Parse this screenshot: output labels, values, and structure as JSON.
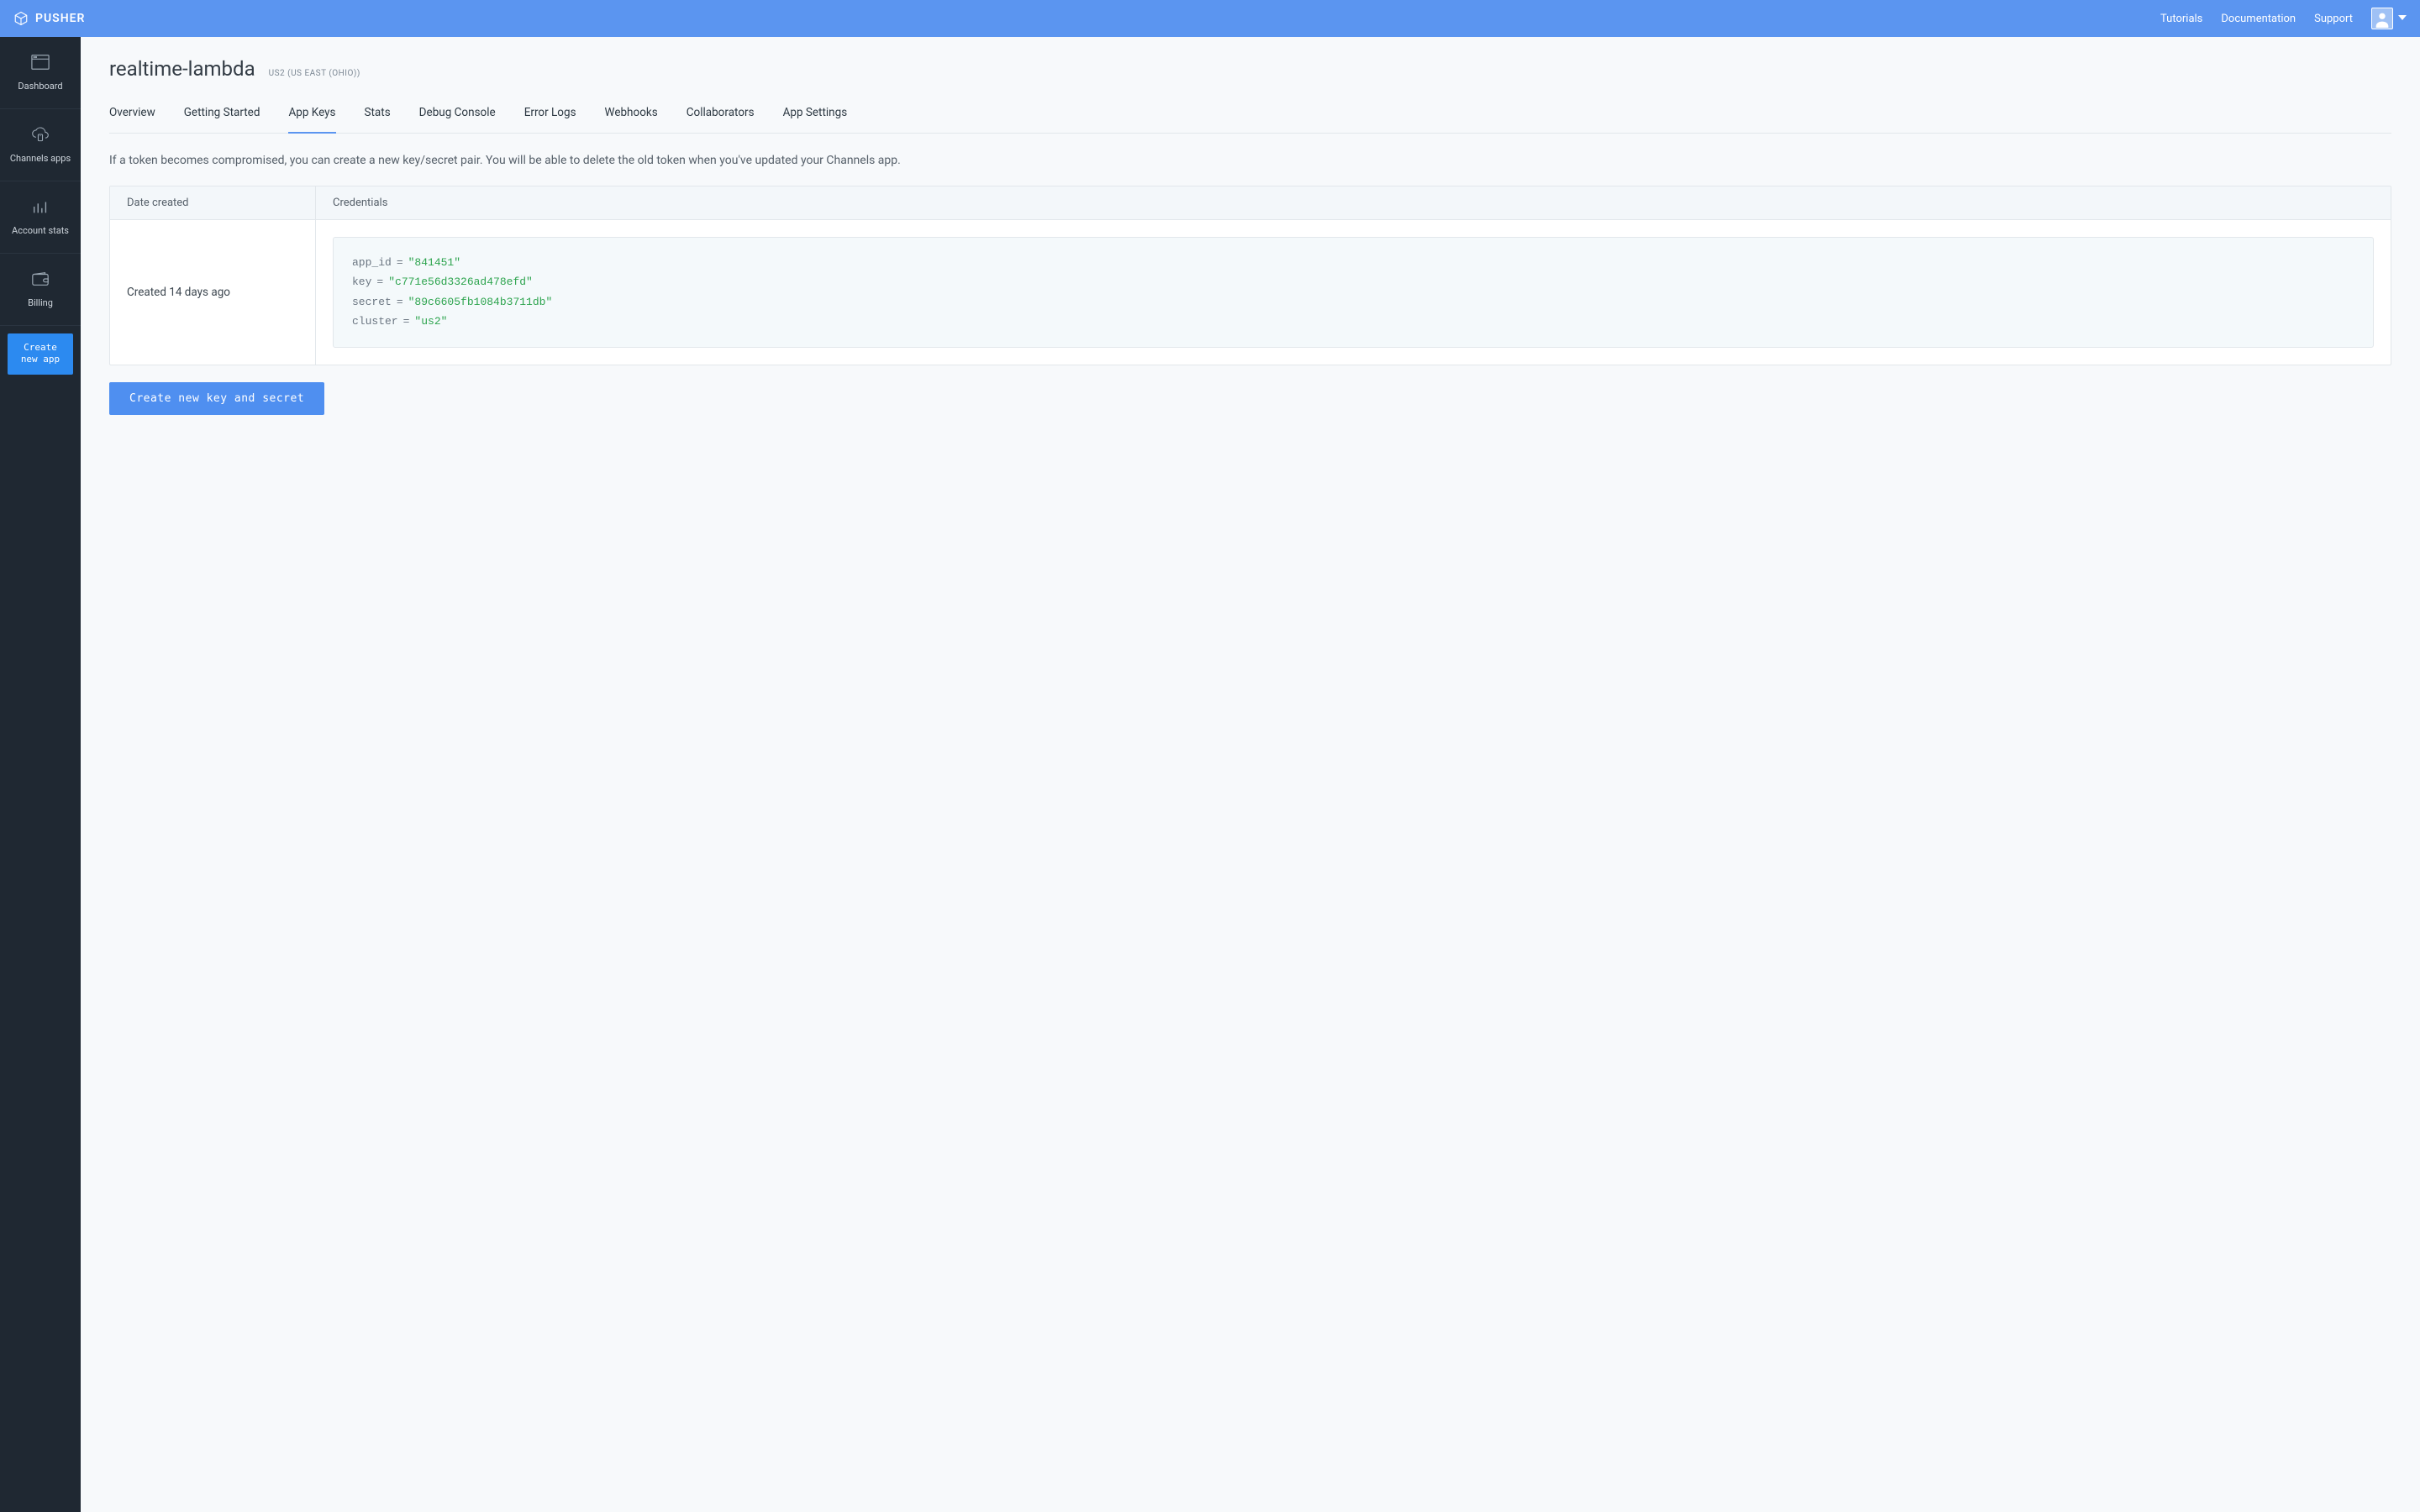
{
  "header": {
    "brand": "PUSHER",
    "nav": {
      "tutorials": "Tutorials",
      "documentation": "Documentation",
      "support": "Support"
    }
  },
  "sidebar": {
    "dashboard": "Dashboard",
    "channels_apps": "Channels apps",
    "account_stats": "Account stats",
    "billing": "Billing",
    "create_new_app": "Create new app"
  },
  "page": {
    "title": "realtime-lambda",
    "cluster_label": "US2 (US EAST (OHIO))"
  },
  "tabs": {
    "overview": "Overview",
    "getting_started": "Getting Started",
    "app_keys": "App Keys",
    "stats": "Stats",
    "debug_console": "Debug Console",
    "error_logs": "Error Logs",
    "webhooks": "Webhooks",
    "collaborators": "Collaborators",
    "app_settings": "App Settings",
    "active": "app_keys"
  },
  "app_keys": {
    "helper_text": "If a token becomes compromised, you can create a new key/secret pair. You will be able to delete the old token when you've updated your Channels app.",
    "columns": {
      "date_created": "Date created",
      "credentials": "Credentials"
    },
    "rows": [
      {
        "created": "Created 14 days ago",
        "credentials": {
          "app_id_label": "app_id",
          "app_id_value": "\"841451\"",
          "key_label": "key",
          "key_value": "\"c771e56d3326ad478efd\"",
          "secret_label": "secret",
          "secret_value": "\"89c6605fb1084b3711db\"",
          "cluster_label": "cluster",
          "cluster_value": "\"us2\"",
          "eq": "="
        }
      }
    ],
    "create_button": "Create new key and secret"
  }
}
